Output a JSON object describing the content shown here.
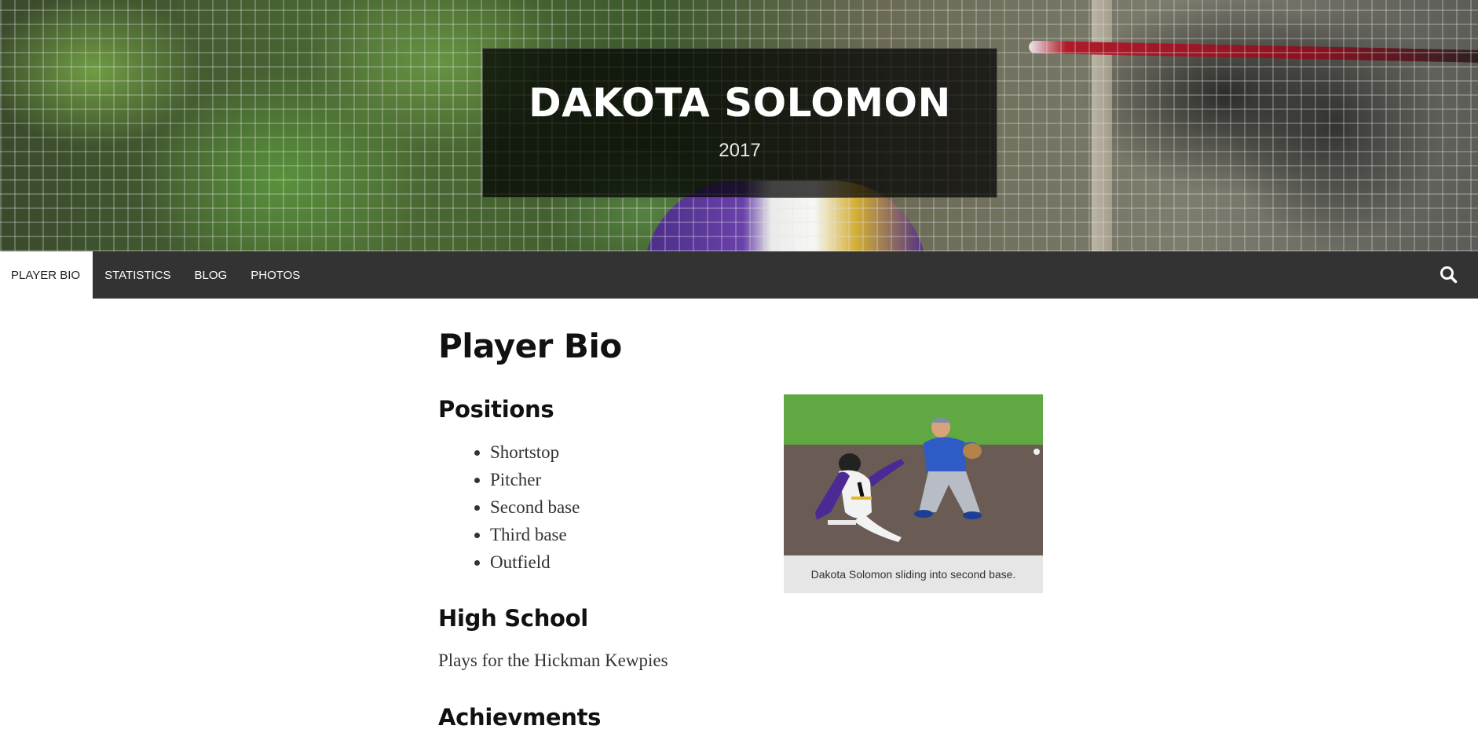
{
  "site": {
    "title": "DAKOTA SOLOMON",
    "subtitle": "2017"
  },
  "nav": {
    "items": [
      {
        "label": "PLAYER BIO",
        "active": true
      },
      {
        "label": "STATISTICS",
        "active": false
      },
      {
        "label": "BLOG",
        "active": false
      },
      {
        "label": "PHOTOS",
        "active": false
      }
    ],
    "search_icon": "search-icon"
  },
  "page": {
    "title": "Player Bio",
    "positions_heading": "Positions",
    "positions": [
      "Shortstop",
      "Pitcher",
      "Second base",
      "Third base",
      "Outfield"
    ],
    "high_school_heading": "High School",
    "high_school_text": "Plays for the Hickman Kewpies",
    "achievements_heading": "Achievments"
  },
  "figure": {
    "caption": "Dakota Solomon sliding into second base."
  },
  "colors": {
    "nav_background": "#333333",
    "nav_active_background": "#ffffff",
    "title_box_background": "rgba(0,0,0,0.72)"
  }
}
